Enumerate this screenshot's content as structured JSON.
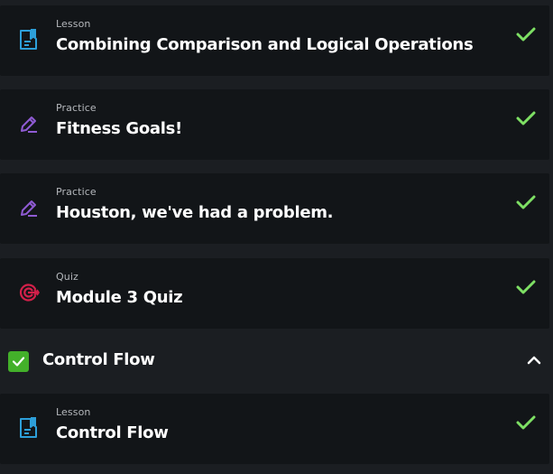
{
  "colors": {
    "background": "#1b1e22",
    "card": "#121518",
    "check": "#7ee064",
    "lesson_icon": "#2d9fd9",
    "practice_icon": "#8f5bd3",
    "quiz_icon": "#d4204a",
    "section_checkbox": "#43b02a"
  },
  "items": [
    {
      "type": "Lesson",
      "title": "Combining Comparison and Logical Operations",
      "icon": "lesson-document-icon",
      "completed": true
    },
    {
      "type": "Practice",
      "title": "Fitness Goals!",
      "icon": "practice-pencil-icon",
      "completed": true
    },
    {
      "type": "Practice",
      "title": "Houston, we've had a problem.",
      "icon": "practice-pencil-icon",
      "completed": true
    },
    {
      "type": "Quiz",
      "title": "Module 3 Quiz",
      "icon": "quiz-target-icon",
      "completed": true
    }
  ],
  "section": {
    "title": "Control Flow",
    "checked": true,
    "expanded": true,
    "items": [
      {
        "type": "Lesson",
        "title": "Control Flow",
        "icon": "lesson-document-icon",
        "completed": true
      }
    ]
  }
}
